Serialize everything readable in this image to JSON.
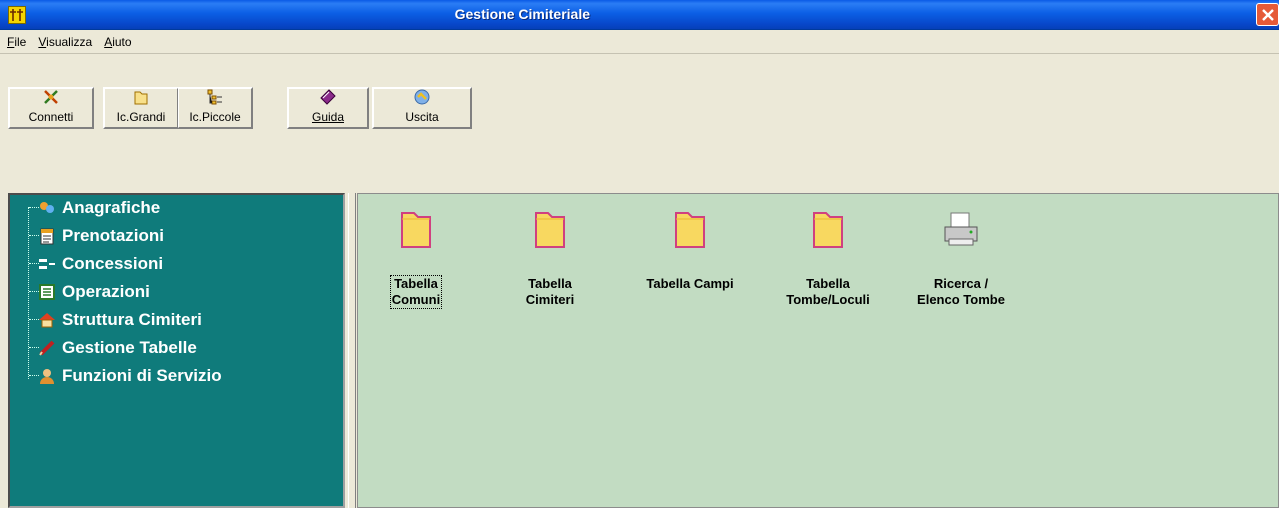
{
  "window": {
    "title": "Gestione Cimiteriale"
  },
  "menu": {
    "items": [
      {
        "label": "File",
        "accel": "F"
      },
      {
        "label": "Visualizza",
        "accel": "V"
      },
      {
        "label": "Aiuto",
        "accel": "A"
      }
    ]
  },
  "toolbar": {
    "buttons": [
      {
        "label": "Connetti",
        "icon": "connect-icon"
      },
      {
        "label": "Ic.Grandi",
        "icon": "large-icons-icon"
      },
      {
        "label": "Ic.Piccole",
        "icon": "small-icons-icon"
      },
      {
        "label": "Guida",
        "icon": "help-book-icon"
      },
      {
        "label": "Uscita",
        "icon": "exit-icon"
      }
    ]
  },
  "tree": {
    "items": [
      {
        "label": "Anagrafiche",
        "icon": "people-icon"
      },
      {
        "label": "Prenotazioni",
        "icon": "clipboard-icon"
      },
      {
        "label": "Concessioni",
        "icon": "hierarchy-icon"
      },
      {
        "label": "Operazioni",
        "icon": "list-icon"
      },
      {
        "label": "Struttura Cimiteri",
        "icon": "house-icon"
      },
      {
        "label": "Gestione Tabelle",
        "icon": "pencil-icon"
      },
      {
        "label": "Funzioni di Servizio",
        "icon": "service-icon"
      }
    ]
  },
  "panel": {
    "items": [
      {
        "label": "Tabella\nComuni",
        "icon": "folder-icon",
        "selected": true
      },
      {
        "label": "Tabella\nCimiteri",
        "icon": "folder-icon",
        "selected": false
      },
      {
        "label": "Tabella Campi",
        "icon": "folder-icon",
        "selected": false
      },
      {
        "label": "Tabella\nTombe/Loculi",
        "icon": "folder-icon",
        "selected": false
      },
      {
        "label": "Ricerca /\nElenco Tombe",
        "icon": "printer-icon",
        "selected": false
      }
    ]
  },
  "colors": {
    "tree_bg": "#0f7b7b",
    "panel_bg": "#c2dcc2",
    "titlebar": "#0c5fe5"
  }
}
